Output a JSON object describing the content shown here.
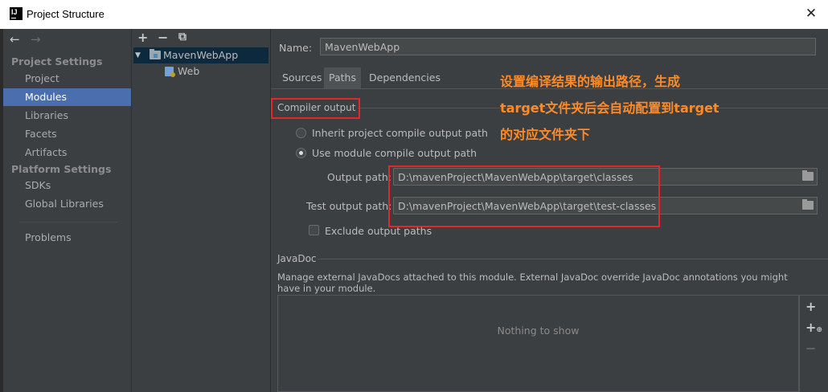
{
  "window": {
    "title": "Project Structure",
    "close": "✕"
  },
  "nav": {
    "back": "←",
    "forward": "→"
  },
  "sidebar": {
    "project_settings_header": "Project Settings",
    "project_settings": [
      "Project",
      "Modules",
      "Libraries",
      "Facets",
      "Artifacts"
    ],
    "platform_settings_header": "Platform Settings",
    "platform_settings": [
      "SDKs",
      "Global Libraries"
    ],
    "other": [
      "Problems"
    ],
    "selected": "Modules"
  },
  "tree_toolbar": {
    "add": "+",
    "remove": "−",
    "copy": "⧉"
  },
  "tree": {
    "module": "MavenWebApp",
    "facet": "Web"
  },
  "module": {
    "name_label": "Name:",
    "name_value": "MavenWebApp",
    "tabs": [
      "Sources",
      "Paths",
      "Dependencies"
    ],
    "selected_tab": "Paths"
  },
  "compiler_output": {
    "title": "Compiler output",
    "inherit_option": "Inherit project compile output path",
    "module_option": "Use module compile output path",
    "selected_option": "Use module compile output path",
    "output_label": "Output path:",
    "output_value": "D:\\mavenProject\\MavenWebApp\\target\\classes",
    "test_label": "Test output path:",
    "test_value": "D:\\mavenProject\\MavenWebApp\\target\\test-classes",
    "exclude_label": "Exclude output paths",
    "exclude_checked": false
  },
  "javadoc": {
    "title": "JavaDoc",
    "description": "Manage external JavaDocs attached to this module. External JavaDoc override JavaDoc annotations you might have in your module.",
    "empty": "Nothing to show",
    "tools": {
      "add": "+",
      "add_url": "+",
      "remove": "−"
    }
  },
  "annotation": {
    "lines": [
      "设置编译结果的输出路径，生成",
      "target文件夹后会自动配置到target",
      "的对应文件夹下"
    ],
    "color": "#ff8a28",
    "box_color": "#e0292b"
  }
}
